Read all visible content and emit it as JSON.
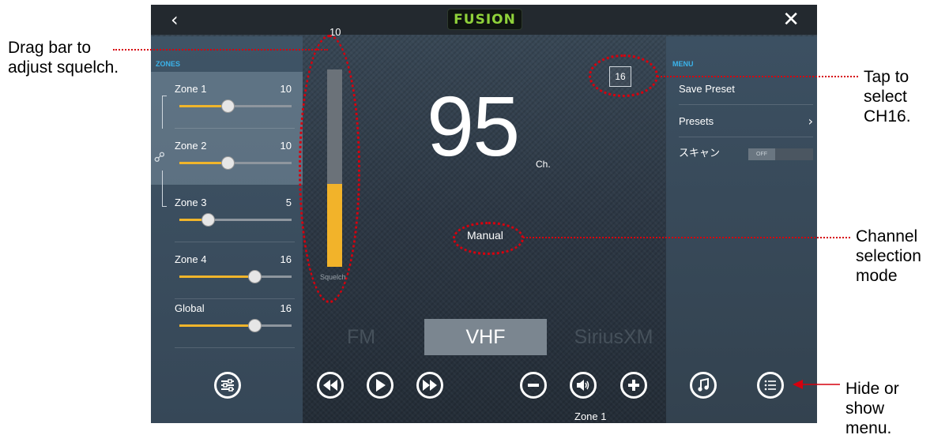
{
  "header": {
    "back_icon": "chevron-left-icon",
    "logo_text": "FUSION",
    "close_icon": "close-icon"
  },
  "zones": {
    "title": "ZONES",
    "items": [
      {
        "name": "Zone 1",
        "value": "10",
        "level": 0.43,
        "linked": true
      },
      {
        "name": "Zone 2",
        "value": "10",
        "level": 0.43,
        "linked": true
      },
      {
        "name": "Zone 3",
        "value": "5",
        "level": 0.25,
        "linked": false
      },
      {
        "name": "Zone 4",
        "value": "16",
        "level": 0.67,
        "linked": false
      },
      {
        "name": "Global",
        "value": "16",
        "level": 0.67,
        "linked": false
      }
    ],
    "link_icon": "chain-link-icon",
    "settings_icon": "sliders-settings-icon"
  },
  "squelch": {
    "value": "10",
    "label": "Squelch",
    "level": 0.42
  },
  "tuner": {
    "channel": "95",
    "channel_unit": "Ch.",
    "preset_channel": "16",
    "mode": "Manual"
  },
  "bands": [
    "FM",
    "VHF",
    "SiriusXM"
  ],
  "active_band": "VHF",
  "controls": {
    "prev_icon": "rewind-icon",
    "play_icon": "play-icon",
    "next_icon": "fast-forward-icon",
    "volume_down_icon": "minus-icon",
    "mute_icon": "speaker-icon",
    "volume_up_icon": "plus-icon",
    "zone_label": "Zone 1",
    "music_icon": "music-note-icon",
    "menu_icon": "list-menu-icon"
  },
  "menu": {
    "title": "MENU",
    "save_preset": "Save Preset",
    "presets": "Presets",
    "scan": "スキャン",
    "scan_state": "OFF"
  },
  "annotations": {
    "squelch": [
      "Drag bar to",
      "adjust squelch."
    ],
    "ch16": [
      "Tap to",
      "select",
      "CH16."
    ],
    "mode": [
      "Channel",
      "selection",
      "mode"
    ],
    "menu": [
      "Hide or",
      "show",
      "menu."
    ]
  },
  "colors": {
    "accent": "#f0b52b",
    "header_text": "#3bb3ea",
    "annotation": "#d6000e",
    "logo_green": "#8fd13a"
  }
}
